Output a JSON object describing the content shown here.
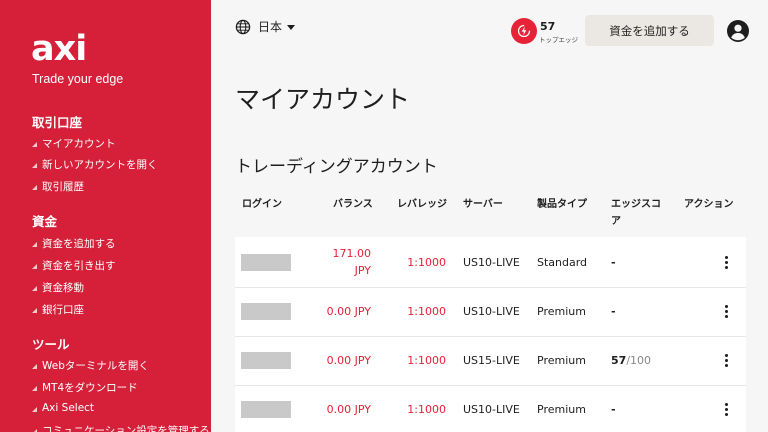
{
  "sidebar": {
    "logo": "axi",
    "tagline": "Trade your edge",
    "sections": [
      {
        "title": "取引口座",
        "items": [
          "マイアカウント",
          "新しいアカウントを開く",
          "取引履歴"
        ]
      },
      {
        "title": "資金",
        "items": [
          "資金を追加する",
          "資金を引き出す",
          "資金移動",
          "銀行口座"
        ]
      },
      {
        "title": "ツール",
        "items": [
          "Webターミナルを開く",
          "MT4をダウンロード",
          "Axi Select",
          "コミュニケーション設定を管理する"
        ]
      }
    ]
  },
  "header": {
    "language": "日本",
    "edge_score": "57",
    "edge_label": "トップエッジ",
    "add_funds_label": "資金を追加する",
    "globe_icon": "globe-icon",
    "user_icon": "user-circle-icon",
    "edge_icon": "lightning-icon"
  },
  "main": {
    "title": "マイアカウント",
    "section_title": "トレーディングアカウント"
  },
  "table": {
    "headers": [
      "ログイン",
      "バランス",
      "レバレッジ",
      "サーバー",
      "製品タイプ",
      "エッジスコア",
      "アクション"
    ],
    "rows": [
      {
        "balance_amount": "171.00",
        "balance_currency": "JPY",
        "leverage": "1:1000",
        "server": "US10-LIVE",
        "product": "Standard",
        "score": "-",
        "score_max": ""
      },
      {
        "balance_amount": "0.00",
        "balance_currency": "JPY",
        "leverage": "1:1000",
        "server": "US10-LIVE",
        "product": "Premium",
        "score": "-",
        "score_max": ""
      },
      {
        "balance_amount": "0.00",
        "balance_currency": "JPY",
        "leverage": "1:1000",
        "server": "US15-LIVE",
        "product": "Premium",
        "score": "57",
        "score_max": "/100"
      },
      {
        "balance_amount": "0.00",
        "balance_currency": "JPY",
        "leverage": "1:1000",
        "server": "US10-LIVE",
        "product": "Premium",
        "score": "-",
        "score_max": ""
      }
    ]
  },
  "colors": {
    "brand_red": "#d6203a",
    "accent_red": "#e52236",
    "button_bg": "#ebe8e3",
    "background": "#f6f6f6"
  }
}
